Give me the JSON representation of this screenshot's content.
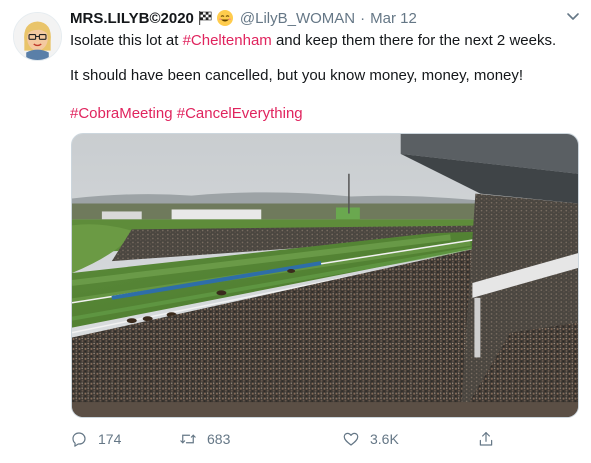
{
  "tweet": {
    "display_name": "MRS.LILYB©2020",
    "handle": "@LilyB_WOMAN",
    "separator": "·",
    "date": "Mar 12",
    "line1_prefix": "Isolate this lot at ",
    "line1_hashtag": "#Cheltenham",
    "line1_suffix": " and keep them there for the next 2 weeks.",
    "line2": "It should have been cancelled, but you know money, money, money!",
    "hashtags": [
      "#CobraMeeting",
      "#CancelEverything"
    ],
    "media_alt": "",
    "actions": {
      "reply_count": "174",
      "retweet_count": "683",
      "like_count": "3.6K"
    },
    "icons": {
      "avatar": "cartoon-woman-avatar",
      "flag": "chequered-flag-emoji",
      "face": "smiling-face-emoji",
      "caret": "chevron-down-icon",
      "reply": "reply-icon",
      "retweet": "retweet-icon",
      "like": "heart-icon",
      "share": "share-icon"
    },
    "colors": {
      "hashtag": "#e0245e",
      "secondary_text": "#657786",
      "primary_text": "#14171a"
    }
  }
}
